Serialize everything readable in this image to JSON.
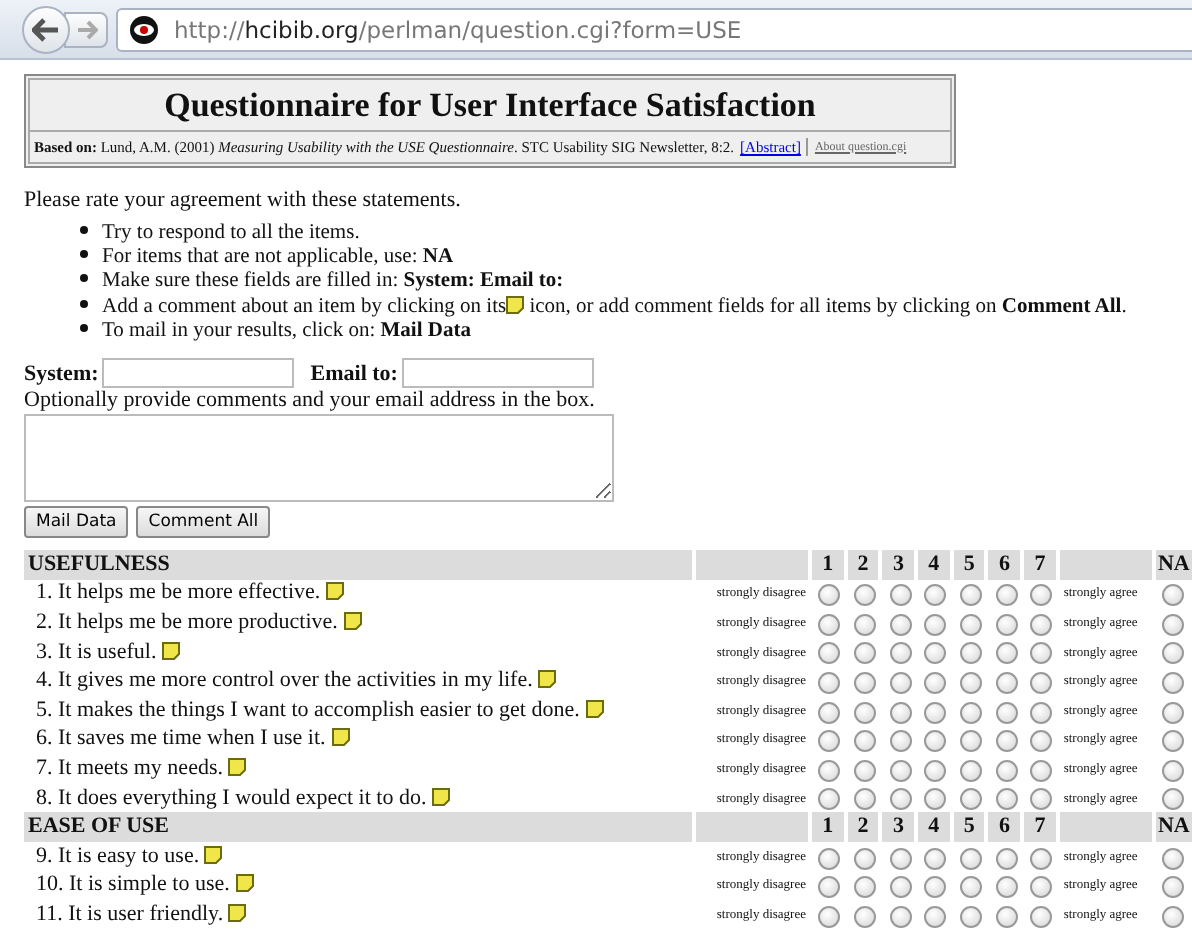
{
  "browser": {
    "url": {
      "scheme": "http://",
      "host": "hcibib.org",
      "path": "/perlman/question.cgi?form=USE"
    }
  },
  "header": {
    "title": "Questionnaire for User Interface Satisfaction",
    "citation": "**Based on:** Lund, A.M. (2001) *Measuring Usability with the USE Questionnaire*. STC Usability SIG Newsletter, 8:2.",
    "abstract_link": "[Abstract]",
    "about_link": "About question.cgi"
  },
  "intro": "Please rate your agreement with these statements.",
  "instructions": [
    {
      "text": "Try to respond to all the items."
    },
    {
      "text": "For items that are not applicable, use: **NA**"
    },
    {
      "text": "Make sure these fields are filled in: **System:**   **Email to:**"
    },
    {
      "text": "Add a comment about an item by clicking on its",
      "text_after": "icon, or add comment fields for all items by clicking on **Comment All**."
    },
    {
      "text": "To mail in your results, click on: **Mail Data**"
    }
  ],
  "fields": [
    {
      "label": "System:"
    },
    {
      "label": "Email to:"
    }
  ],
  "comment_prompt": "Optionally provide comments and your email address in the box.",
  "buttons": [
    "Mail Data",
    "Comment All"
  ],
  "sections": [
    {
      "title": "USEFULNESS",
      "scale": [
        "1",
        "2",
        "3",
        "4",
        "5",
        "6",
        "7"
      ],
      "na": "NA",
      "items": [
        {
          "text": "1. It helps me be more effective.",
          "low": "strongly disagree",
          "high": "strongly agree",
          "options": [
            {
              "selected": false
            },
            {
              "selected": false
            },
            {
              "selected": false
            },
            {
              "selected": false
            },
            {
              "selected": false
            },
            {
              "selected": false
            },
            {
              "selected": false
            },
            {
              "selected": false
            }
          ]
        },
        {
          "text": "2. It helps me be more productive.",
          "low": "strongly disagree",
          "high": "strongly agree",
          "options": [
            {
              "selected": false
            },
            {
              "selected": false
            },
            {
              "selected": false
            },
            {
              "selected": false
            },
            {
              "selected": false
            },
            {
              "selected": false
            },
            {
              "selected": false
            },
            {
              "selected": false
            }
          ]
        },
        {
          "text": "3. It is useful.",
          "low": "strongly disagree",
          "high": "strongly agree",
          "options": [
            {
              "selected": false
            },
            {
              "selected": false
            },
            {
              "selected": false
            },
            {
              "selected": false
            },
            {
              "selected": false
            },
            {
              "selected": false
            },
            {
              "selected": false
            },
            {
              "selected": false
            }
          ]
        },
        {
          "text": "4. It gives me more control over the activities in my life.",
          "low": "strongly disagree",
          "high": "strongly agree",
          "options": [
            {
              "selected": false
            },
            {
              "selected": false
            },
            {
              "selected": false
            },
            {
              "selected": false
            },
            {
              "selected": false
            },
            {
              "selected": false
            },
            {
              "selected": false
            },
            {
              "selected": false
            }
          ]
        },
        {
          "text": "5. It makes the things I want to accomplish easier to get done.",
          "low": "strongly disagree",
          "high": "strongly agree",
          "options": [
            {
              "selected": false
            },
            {
              "selected": false
            },
            {
              "selected": false
            },
            {
              "selected": false
            },
            {
              "selected": false
            },
            {
              "selected": false
            },
            {
              "selected": false
            },
            {
              "selected": false
            }
          ]
        },
        {
          "text": "6. It saves me time when I use it.",
          "low": "strongly disagree",
          "high": "strongly agree",
          "options": [
            {
              "selected": false
            },
            {
              "selected": false
            },
            {
              "selected": false
            },
            {
              "selected": false
            },
            {
              "selected": false
            },
            {
              "selected": false
            },
            {
              "selected": false
            },
            {
              "selected": false
            }
          ]
        },
        {
          "text": "7. It meets my needs.",
          "low": "strongly disagree",
          "high": "strongly agree",
          "options": [
            {
              "selected": false
            },
            {
              "selected": false
            },
            {
              "selected": false
            },
            {
              "selected": false
            },
            {
              "selected": false
            },
            {
              "selected": false
            },
            {
              "selected": false
            },
            {
              "selected": false
            }
          ]
        },
        {
          "text": "8. It does everything I would expect it to do.",
          "low": "strongly disagree",
          "high": "strongly agree",
          "options": [
            {
              "selected": false
            },
            {
              "selected": false
            },
            {
              "selected": false
            },
            {
              "selected": false
            },
            {
              "selected": false
            },
            {
              "selected": false
            },
            {
              "selected": false
            },
            {
              "selected": false
            }
          ]
        }
      ]
    },
    {
      "title": "EASE OF USE",
      "scale": [
        "1",
        "2",
        "3",
        "4",
        "5",
        "6",
        "7"
      ],
      "na": "NA",
      "items": [
        {
          "text": "9. It is easy to use.",
          "low": "strongly disagree",
          "high": "strongly agree",
          "options": [
            {
              "selected": false
            },
            {
              "selected": false
            },
            {
              "selected": false
            },
            {
              "selected": false
            },
            {
              "selected": false
            },
            {
              "selected": false
            },
            {
              "selected": false
            },
            {
              "selected": false
            }
          ]
        },
        {
          "text": "10. It is simple to use.",
          "low": "strongly disagree",
          "high": "strongly agree",
          "options": [
            {
              "selected": false
            },
            {
              "selected": false
            },
            {
              "selected": false
            },
            {
              "selected": false
            },
            {
              "selected": false
            },
            {
              "selected": false
            },
            {
              "selected": false
            },
            {
              "selected": false
            }
          ]
        },
        {
          "text": "11. It is user friendly.",
          "low": "strongly disagree",
          "high": "strongly agree",
          "options": [
            {
              "selected": false
            },
            {
              "selected": false
            },
            {
              "selected": false
            },
            {
              "selected": false
            },
            {
              "selected": false
            },
            {
              "selected": false
            },
            {
              "selected": false
            },
            {
              "selected": false
            }
          ]
        }
      ]
    }
  ]
}
